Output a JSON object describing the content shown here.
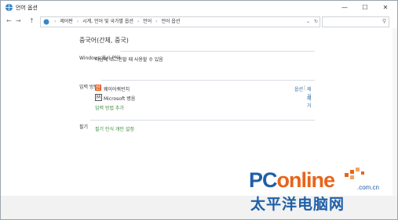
{
  "window": {
    "title": "언어 옵션",
    "controls": {
      "minimize": "—",
      "maximize": "☐",
      "close": "✕"
    }
  },
  "nav": {
    "back": "←",
    "forward": "→",
    "up": "↑",
    "breadcrumb": [
      "제어판",
      "시계, 언어 및 국가별 옵션",
      "언어",
      "언어 옵션"
    ],
    "refresh": "↻",
    "dropdown": "⌄",
    "search_placeholder": ""
  },
  "main": {
    "title": "중국어(간체, 중국)",
    "display_language": {
      "label": "Windows 표시 언어",
      "status": "다음에 로그인할 때 사용할 수 있음"
    },
    "input_method": {
      "label": "입력 방법",
      "items": [
        {
          "icon": "korean-ime-icon",
          "name": "웨이어쿼빈치",
          "actions": [
            "옵션",
            "제거"
          ]
        },
        {
          "icon": "microsoft-ime-icon",
          "name": "Microsoft 병음",
          "actions": [
            "제거"
          ]
        }
      ],
      "add_link": "입력 방법 추가"
    },
    "handwriting": {
      "label": "필기",
      "link": "필기 인식 개인 설정"
    }
  },
  "watermark": {
    "brand_prefix": "PC",
    "brand_suffix": "online",
    "domain": ".com.cn",
    "chinese": "太平洋电脑网"
  },
  "colors": {
    "link_green": "#3c8a3c",
    "brand_blue": "#1f5fa8",
    "brand_orange": "#e8641b"
  }
}
